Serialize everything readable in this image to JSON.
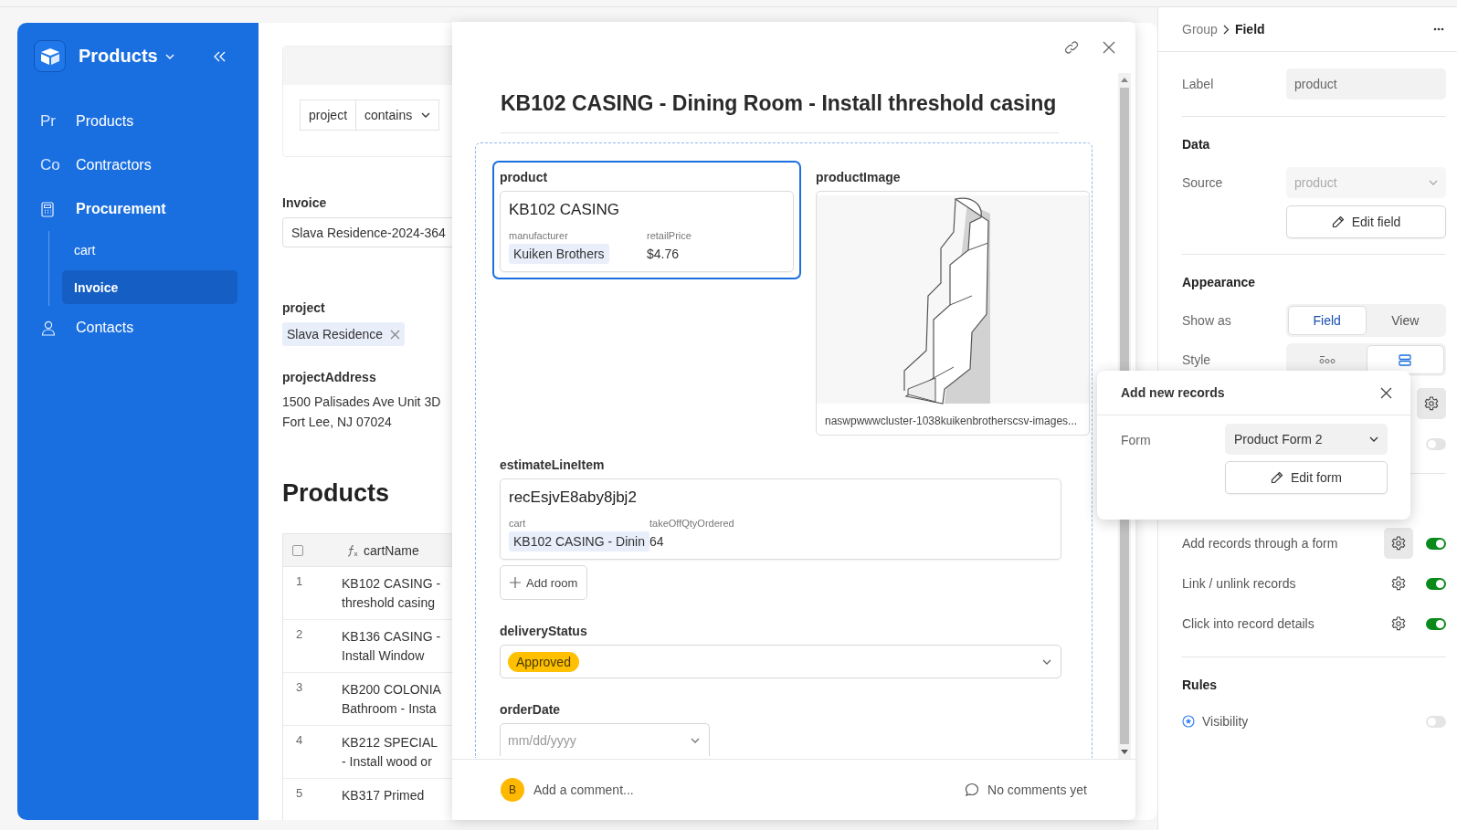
{
  "sidebar": {
    "app_title": "Products",
    "items": [
      {
        "kind": "abbr",
        "abbr": "Pr",
        "label": "Products",
        "expanded": false
      },
      {
        "kind": "abbr",
        "abbr": "Co",
        "label": "Contractors",
        "expanded": false
      },
      {
        "kind": "calculator",
        "label": "Procurement",
        "expanded": true,
        "children": [
          {
            "label": "cart",
            "selected": false
          },
          {
            "label": "Invoice",
            "selected": true
          }
        ]
      },
      {
        "kind": "person",
        "label": "Contacts",
        "expanded": false
      }
    ]
  },
  "page": {
    "filter": {
      "field": "project",
      "operator": "contains"
    },
    "fields": [
      {
        "kind": "input",
        "label": "Invoice",
        "value": "Slava Residence-2024-364"
      },
      {
        "kind": "chip",
        "label": "project",
        "value": "Slava Residence"
      },
      {
        "kind": "text",
        "label": "projectAddress",
        "lines": [
          "1500 Palisades Ave Unit 3D",
          "Fort Lee, NJ 07024"
        ]
      }
    ],
    "section_title": "Products",
    "table": {
      "select_all_checked": false,
      "columns": [
        {
          "kind": "formula",
          "label": "cartName"
        }
      ],
      "rows": [
        {
          "number": "1",
          "lines": [
            "KB102 CASING -",
            "threshold casing"
          ]
        },
        {
          "number": "2",
          "lines": [
            "KB136 CASING -",
            "Install Window"
          ]
        },
        {
          "number": "3",
          "lines": [
            "KB200 COLONIA",
            "Bathroom - Insta"
          ]
        },
        {
          "number": "4",
          "lines": [
            "KB212 SPECIAL",
            "- Install wood or"
          ]
        },
        {
          "number": "5",
          "lines": [
            "KB317 Primed"
          ]
        }
      ]
    }
  },
  "modal": {
    "title": "KB102 CASING - Dining Room - Install threshold casing",
    "rows": [
      [
        {
          "kind": "record",
          "label": "product",
          "selected": true,
          "title": "KB102 CASING",
          "props": [
            {
              "name": "manufacturer",
              "value": "Kuiken Brothers",
              "kind": "chip"
            },
            {
              "name": "retailPrice",
              "value": "$4.76",
              "kind": "text"
            }
          ]
        },
        {
          "label": "productImage",
          "caption": "naswpwwwcluster-1038kuikenbrotherscsv-images..."
        }
      ],
      [
        {
          "kind": "record",
          "label": "estimateLineItem",
          "selected": false,
          "title": "recEsjvE8aby8jbj2",
          "props": [
            {
              "name": "cart",
              "value": "KB102 CASING - Dinin",
              "kind": "chip"
            },
            {
              "name": "takeOffQtyOrdered",
              "value": "64",
              "kind": "text"
            }
          ],
          "button": "Add room"
        }
      ],
      [
        {
          "kind": "select",
          "label": "deliveryStatus",
          "value": "Approved",
          "color": "#ffc000"
        }
      ],
      [
        {
          "kind": "date",
          "label": "orderDate",
          "placeholder": "mm/dd/yyyy"
        }
      ]
    ],
    "comment": {
      "avatar": "B",
      "placeholder": "Add a comment...",
      "status": "No comments yet"
    }
  },
  "inspector": {
    "breadcrumb": [
      {
        "text": "Group",
        "current": false
      },
      {
        "text": "Field",
        "current": true
      }
    ],
    "label_row": {
      "label": "Label",
      "value": "product"
    },
    "data": {
      "heading": "Data",
      "source_label": "Source",
      "source_value": "product",
      "source_disabled": true,
      "button": "Edit field"
    },
    "appearance": {
      "heading": "Appearance",
      "show_as_label": "Show as",
      "show_as": [
        {
          "label": "Field",
          "selected": true
        },
        {
          "label": "View",
          "selected": false
        }
      ],
      "style_label": "Style",
      "style": [
        {
          "kind": "inline",
          "selected": false
        },
        {
          "kind": "stacked",
          "selected": true
        }
      ]
    },
    "options": [
      {
        "kind": "gear",
        "active": true
      },
      {
        "kind": "toggle",
        "on": false
      }
    ],
    "permissions": [
      {
        "label": "Add records through a form",
        "active": true,
        "on": true
      },
      {
        "label": "Link / unlink records",
        "active": false,
        "on": true
      },
      {
        "label": "Click into record details",
        "active": false,
        "on": true
      }
    ],
    "rules": {
      "heading": "Rules",
      "items": [
        {
          "label": "Visibility",
          "on": false
        }
      ]
    }
  },
  "popover": {
    "title": "Add new records",
    "form_label": "Form",
    "form_value": "Product Form 2",
    "button": "Edit form"
  }
}
